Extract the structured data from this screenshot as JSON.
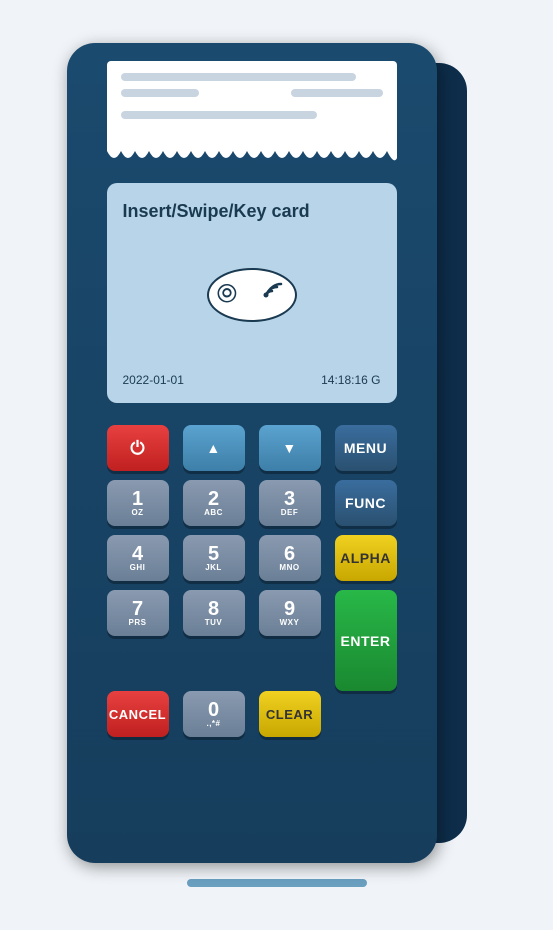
{
  "terminal": {
    "screen": {
      "prompt": "Insert/Swipe/Key card",
      "date": "2022-01-01",
      "time": "14:18:16 G"
    },
    "receipt": {
      "lines": [
        "long",
        "medium",
        "xshort"
      ]
    },
    "keys": {
      "row1": [
        {
          "label": "▲",
          "type": "blue",
          "name": "up-arrow"
        },
        {
          "label": "▼",
          "type": "blue",
          "name": "down-arrow"
        },
        {
          "label": "MENU",
          "type": "dark-blue",
          "name": "menu"
        }
      ],
      "row2": [
        {
          "main": "1",
          "sub": "OZ",
          "type": "gray",
          "name": "key-1"
        },
        {
          "main": "2",
          "sub": "ABC",
          "type": "gray",
          "name": "key-2"
        },
        {
          "main": "3",
          "sub": "DEF",
          "type": "gray",
          "name": "key-3"
        },
        {
          "label": "FUNC",
          "type": "dark-blue",
          "name": "func"
        }
      ],
      "row3": [
        {
          "main": "4",
          "sub": "GHI",
          "type": "gray",
          "name": "key-4"
        },
        {
          "main": "5",
          "sub": "JKL",
          "type": "gray",
          "name": "key-5"
        },
        {
          "main": "6",
          "sub": "MNO",
          "type": "gray",
          "name": "key-6"
        },
        {
          "label": "ALPHA",
          "type": "alpha",
          "name": "alpha"
        }
      ],
      "row4": [
        {
          "main": "7",
          "sub": "PRS",
          "type": "gray",
          "name": "key-7"
        },
        {
          "main": "8",
          "sub": "TUV",
          "type": "gray",
          "name": "key-8"
        },
        {
          "main": "9",
          "sub": "WXY",
          "type": "gray",
          "name": "key-9"
        },
        {
          "label": "ENTER",
          "type": "green",
          "name": "enter"
        }
      ],
      "row5": [
        {
          "label": "CANCEL",
          "type": "red",
          "name": "cancel"
        },
        {
          "main": "0",
          "sub": ".,*#",
          "type": "gray",
          "name": "key-0"
        },
        {
          "label": "CLEAR",
          "type": "yellow",
          "name": "clear"
        },
        {
          "label": "",
          "type": "green",
          "name": "enter-bottom"
        }
      ]
    },
    "power_icon": "⏻"
  }
}
